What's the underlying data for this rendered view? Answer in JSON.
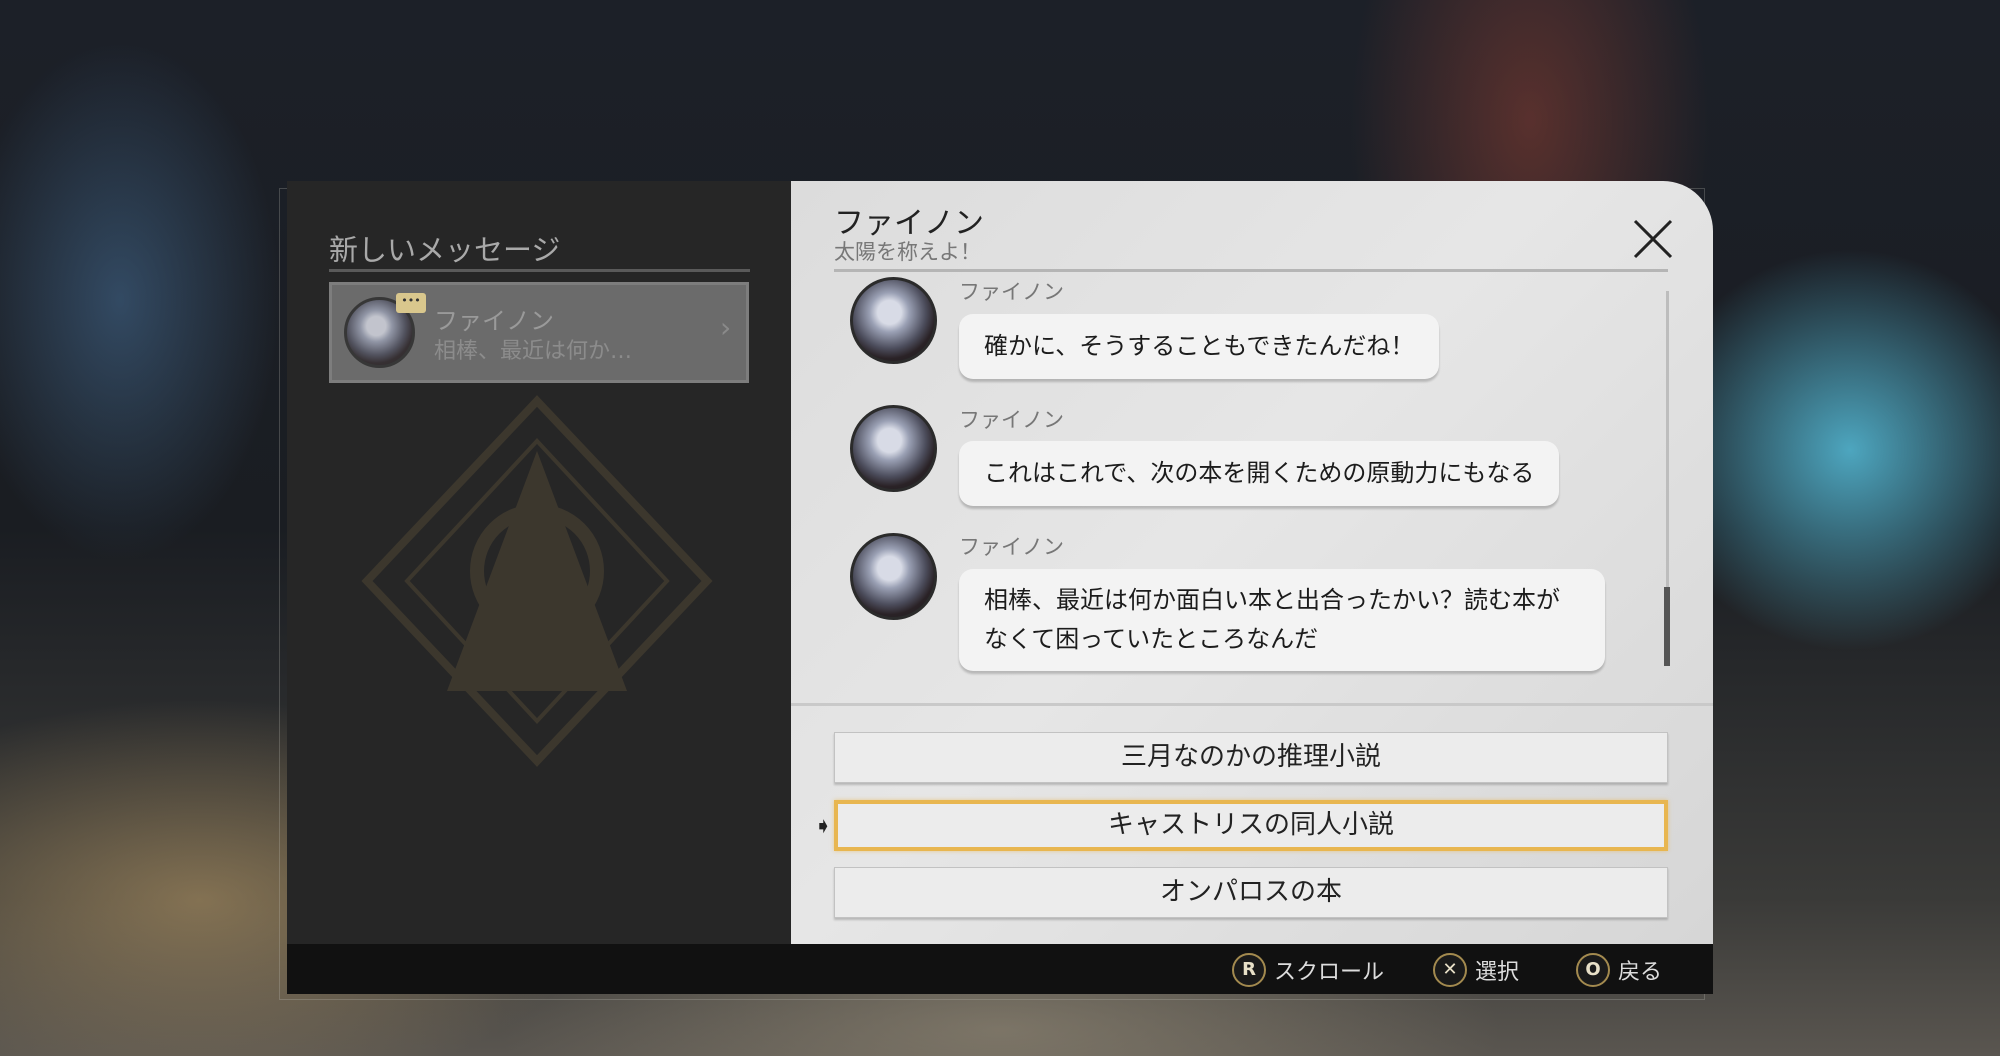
{
  "left": {
    "title": "新しいメッセージ",
    "item": {
      "name": "ファイノン",
      "preview": "相棒、最近は何か…",
      "badge": "•••"
    }
  },
  "chat": {
    "name": "ファイノン",
    "subtitle": "太陽を称えよ！",
    "messages": [
      {
        "sender": "ファイノン",
        "text": "確かに、そうすることもできたんだね！"
      },
      {
        "sender": "ファイノン",
        "text": "これはこれで、次の本を開くための原動力にもなる"
      },
      {
        "sender": "ファイノン",
        "text": "相棒、最近は何か面白い本と出合ったかい？読む本がなくて困っていたところなんだ"
      }
    ],
    "choices": [
      "三月なのかの推理小説",
      "キャストリスの同人小説",
      "オンパロスの本"
    ],
    "selected_choice": 1
  },
  "hints": [
    {
      "key": "R",
      "label": "スクロール"
    },
    {
      "key": "✕",
      "label": "選択"
    },
    {
      "key": "O",
      "label": "戻る"
    }
  ],
  "colors": {
    "accent": "#e8b650"
  }
}
